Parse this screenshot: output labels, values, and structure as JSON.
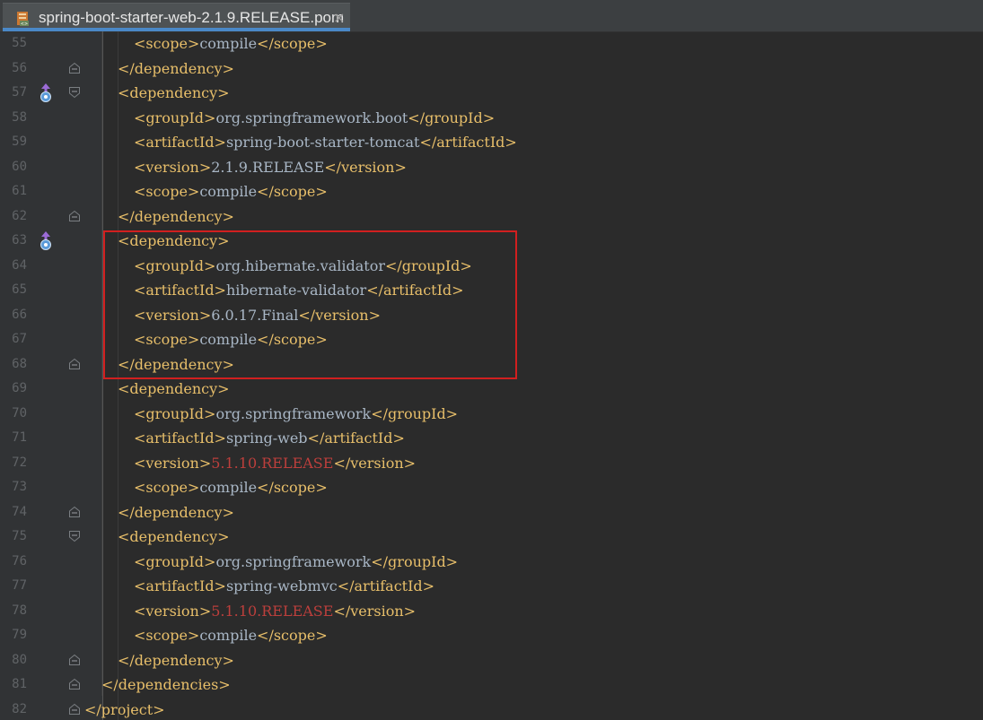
{
  "tab": {
    "title": "spring-boot-starter-web-2.1.9.RELEASE.pom",
    "close": "×",
    "icon": "pom-file-icon"
  },
  "colors": {
    "tag": "#e8bf6a",
    "text": "#a9b7c6",
    "highlightVersion": "#bc3f3c",
    "highlightBox": "#d11f1f",
    "lineNumber": "#606366",
    "background": "#2b2b2b",
    "gutter": "#313335"
  },
  "lines": [
    {
      "n": "55",
      "indent": 2,
      "parts": [
        [
          "tag",
          "<scope>"
        ],
        [
          "txt",
          "compile"
        ],
        [
          "tag",
          "</scope>"
        ]
      ],
      "fold": null,
      "marker": false
    },
    {
      "n": "56",
      "indent": 1,
      "parts": [
        [
          "tag",
          "</dependency>"
        ]
      ],
      "fold": "end",
      "marker": false
    },
    {
      "n": "57",
      "indent": 1,
      "parts": [
        [
          "tag",
          "<dependency>"
        ]
      ],
      "fold": "start",
      "marker": true
    },
    {
      "n": "58",
      "indent": 2,
      "parts": [
        [
          "tag",
          "<groupId>"
        ],
        [
          "txt",
          "org.springframework.boot"
        ],
        [
          "tag",
          "</groupId>"
        ]
      ],
      "fold": null,
      "marker": false
    },
    {
      "n": "59",
      "indent": 2,
      "parts": [
        [
          "tag",
          "<artifactId>"
        ],
        [
          "txt",
          "spring-boot-starter-tomcat"
        ],
        [
          "tag",
          "</artifactId>"
        ]
      ],
      "fold": null,
      "marker": false
    },
    {
      "n": "60",
      "indent": 2,
      "parts": [
        [
          "tag",
          "<version>"
        ],
        [
          "txt",
          "2.1.9.RELEASE"
        ],
        [
          "tag",
          "</version>"
        ]
      ],
      "fold": null,
      "marker": false
    },
    {
      "n": "61",
      "indent": 2,
      "parts": [
        [
          "tag",
          "<scope>"
        ],
        [
          "txt",
          "compile"
        ],
        [
          "tag",
          "</scope>"
        ]
      ],
      "fold": null,
      "marker": false
    },
    {
      "n": "62",
      "indent": 1,
      "parts": [
        [
          "tag",
          "</dependency>"
        ]
      ],
      "fold": "end",
      "marker": false
    },
    {
      "n": "63",
      "indent": 1,
      "parts": [
        [
          "tag",
          "<dependency>"
        ]
      ],
      "fold": null,
      "marker": true
    },
    {
      "n": "64",
      "indent": 2,
      "parts": [
        [
          "tag",
          "<groupId>"
        ],
        [
          "txt",
          "org.hibernate.validator"
        ],
        [
          "tag",
          "</groupId>"
        ]
      ],
      "fold": null,
      "marker": false
    },
    {
      "n": "65",
      "indent": 2,
      "parts": [
        [
          "tag",
          "<artifactId>"
        ],
        [
          "txt",
          "hibernate-validator"
        ],
        [
          "tag",
          "</artifactId>"
        ]
      ],
      "fold": null,
      "marker": false
    },
    {
      "n": "66",
      "indent": 2,
      "parts": [
        [
          "tag",
          "<version>"
        ],
        [
          "txt",
          "6.0.17.Final"
        ],
        [
          "tag",
          "</version>"
        ]
      ],
      "fold": null,
      "marker": false
    },
    {
      "n": "67",
      "indent": 2,
      "parts": [
        [
          "tag",
          "<scope>"
        ],
        [
          "txt",
          "compile"
        ],
        [
          "tag",
          "</scope>"
        ]
      ],
      "fold": null,
      "marker": false
    },
    {
      "n": "68",
      "indent": 1,
      "parts": [
        [
          "tag",
          "</dependency>"
        ]
      ],
      "fold": "end",
      "marker": false
    },
    {
      "n": "69",
      "indent": 1,
      "parts": [
        [
          "tag",
          "<dependency>"
        ]
      ],
      "fold": null,
      "marker": false
    },
    {
      "n": "70",
      "indent": 2,
      "parts": [
        [
          "tag",
          "<groupId>"
        ],
        [
          "txt",
          "org.springframework"
        ],
        [
          "tag",
          "</groupId>"
        ]
      ],
      "fold": null,
      "marker": false
    },
    {
      "n": "71",
      "indent": 2,
      "parts": [
        [
          "tag",
          "<artifactId>"
        ],
        [
          "txt",
          "spring-web"
        ],
        [
          "tag",
          "</artifactId>"
        ]
      ],
      "fold": null,
      "marker": false
    },
    {
      "n": "72",
      "indent": 2,
      "parts": [
        [
          "tag",
          "<version>"
        ],
        [
          "red",
          "5.1.10.RELEASE"
        ],
        [
          "tag",
          "</version>"
        ]
      ],
      "fold": null,
      "marker": false
    },
    {
      "n": "73",
      "indent": 2,
      "parts": [
        [
          "tag",
          "<scope>"
        ],
        [
          "txt",
          "compile"
        ],
        [
          "tag",
          "</scope>"
        ]
      ],
      "fold": null,
      "marker": false
    },
    {
      "n": "74",
      "indent": 1,
      "parts": [
        [
          "tag",
          "</dependency>"
        ]
      ],
      "fold": "end",
      "marker": false
    },
    {
      "n": "75",
      "indent": 1,
      "parts": [
        [
          "tag",
          "<dependency>"
        ]
      ],
      "fold": "start",
      "marker": false
    },
    {
      "n": "76",
      "indent": 2,
      "parts": [
        [
          "tag",
          "<groupId>"
        ],
        [
          "txt",
          "org.springframework"
        ],
        [
          "tag",
          "</groupId>"
        ]
      ],
      "fold": null,
      "marker": false
    },
    {
      "n": "77",
      "indent": 2,
      "parts": [
        [
          "tag",
          "<artifactId>"
        ],
        [
          "txt",
          "spring-webmvc"
        ],
        [
          "tag",
          "</artifactId>"
        ]
      ],
      "fold": null,
      "marker": false
    },
    {
      "n": "78",
      "indent": 2,
      "parts": [
        [
          "tag",
          "<version>"
        ],
        [
          "red",
          "5.1.10.RELEASE"
        ],
        [
          "tag",
          "</version>"
        ]
      ],
      "fold": null,
      "marker": false
    },
    {
      "n": "79",
      "indent": 2,
      "parts": [
        [
          "tag",
          "<scope>"
        ],
        [
          "txt",
          "compile"
        ],
        [
          "tag",
          "</scope>"
        ]
      ],
      "fold": null,
      "marker": false
    },
    {
      "n": "80",
      "indent": 1,
      "parts": [
        [
          "tag",
          "</dependency>"
        ]
      ],
      "fold": "end",
      "marker": false
    },
    {
      "n": "81",
      "indent": 0,
      "parts": [
        [
          "tag",
          "</dependencies>"
        ]
      ],
      "fold": "end",
      "marker": false
    },
    {
      "n": "82",
      "indent": -1,
      "parts": [
        [
          "tag",
          "</project>"
        ]
      ],
      "fold": "end",
      "marker": false
    }
  ]
}
